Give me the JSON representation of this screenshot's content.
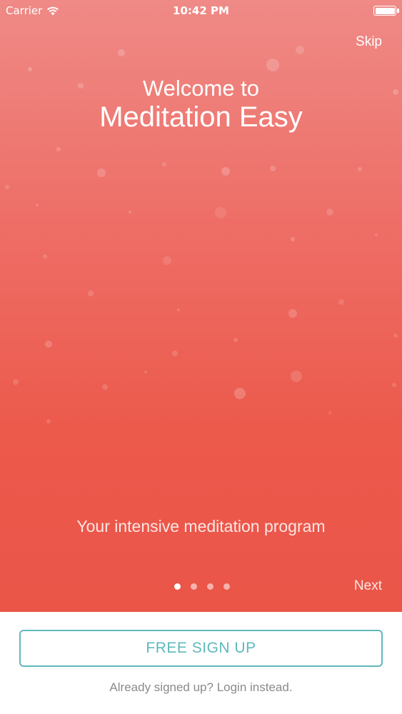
{
  "status_bar": {
    "carrier": "Carrier",
    "time": "10:42 PM",
    "wifi_icon": "wifi-icon",
    "battery_icon": "battery-icon",
    "battery_level": 1.0
  },
  "hero": {
    "skip_label": "Skip",
    "welcome_line": "Welcome to",
    "app_name": "Meditation Easy",
    "tagline": "Your intensive meditation program",
    "next_label": "Next",
    "pager": {
      "total": 4,
      "active": 0
    }
  },
  "bottom": {
    "signup_label": "FREE SIGN UP",
    "login_text": "Already signed up? Login instead."
  },
  "colors": {
    "accent": "#5fb8bd",
    "hero_top": "#ef8a86",
    "hero_bottom": "#ea5548",
    "muted_text": "#8a8a8a"
  }
}
